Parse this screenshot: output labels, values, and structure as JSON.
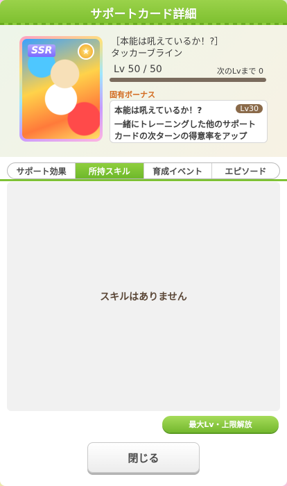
{
  "title": "サポートカード詳細",
  "card": {
    "rarity": "SSR",
    "type_icon": "wit-type-icon",
    "title_line": "［本能は吼えているか！?］",
    "name": "タッカーブライン",
    "level_text": "Lv 50 / 50",
    "next_lv_label": "次のLvまで 0",
    "level_progress": 1.0
  },
  "bonus": {
    "section_title": "固有ボーナス",
    "name": "本能は吼えているか！?",
    "level_badge": "Lv30",
    "description_line1": "一緒にトレーニングした他のサポート",
    "description_line2": "カードの次ターンの得意率をアップ"
  },
  "tabs": [
    {
      "label": "サポート効果",
      "active": false
    },
    {
      "label": "所持スキル",
      "active": true
    },
    {
      "label": "育成イベント",
      "active": false
    },
    {
      "label": "エピソード",
      "active": false
    }
  ],
  "content": {
    "empty_message": "スキルはありません"
  },
  "buttons": {
    "max_lv": "最大Lv・上限解放",
    "close": "閉じる"
  },
  "colors": {
    "accent_green": "#7cbf2e",
    "text_brown": "#5a4636",
    "bonus_orange": "#d26a1e"
  }
}
